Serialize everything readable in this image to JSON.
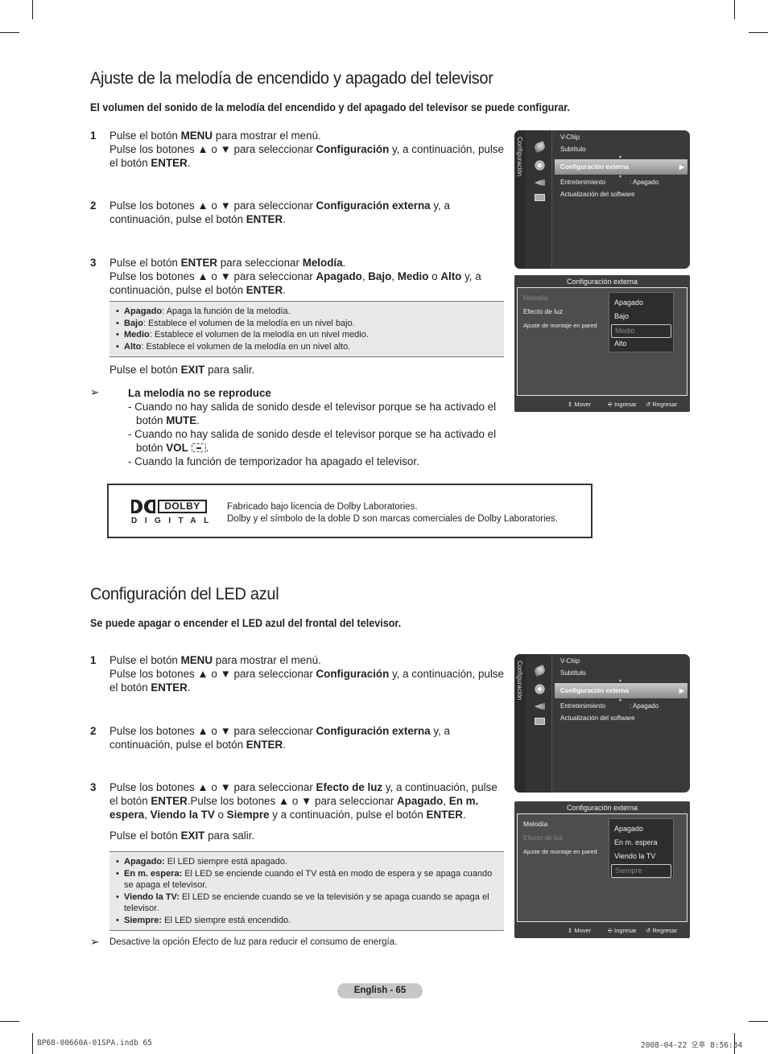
{
  "section1": {
    "title": "Ajuste de la melodía de encendido y apagado del televisor",
    "subtitle": "El volumen del sonido de la melodía del encendido y del apagado del televisor se puede configurar.",
    "steps": [
      {
        "num": "1",
        "lines": [
          [
            "Pulse el botón ",
            {
              "b": "MENU"
            },
            " para mostrar el menú."
          ],
          [
            "Pulse los botones ▲ o ▼ para seleccionar ",
            {
              "b": "Configuración"
            },
            " y, a continuación, pulse el botón ",
            {
              "b": "ENTER"
            },
            "."
          ]
        ]
      },
      {
        "num": "2",
        "lines": [
          [
            "Pulse los botones ▲ o ▼ para seleccionar ",
            {
              "b": "Configuración externa"
            },
            " y, a continuación, pulse el botón ",
            {
              "b": "ENTER"
            },
            "."
          ]
        ]
      },
      {
        "num": "3",
        "lines": [
          [
            "Pulse el botón ",
            {
              "b": "ENTER"
            },
            " para seleccionar ",
            {
              "b": "Melodía"
            },
            "."
          ],
          [
            "Pulse los botones ▲ o ▼ para seleccionar ",
            {
              "b": "Apagado"
            },
            ", ",
            {
              "b": "Bajo"
            },
            ", ",
            {
              "b": "Medio"
            },
            " o ",
            {
              "b": "Alto"
            },
            " y, a continuación, pulse el botón ",
            {
              "b": "ENTER"
            },
            "."
          ]
        ]
      }
    ],
    "options": [
      {
        "term": "Apagado",
        "desc": ": Apaga la función de la melodía."
      },
      {
        "term": "Bajo",
        "desc": ": Establece el volumen de la melodía en un nivel bajo."
      },
      {
        "term": "Medio",
        "desc": ": Establece el volumen de la melodía en un nivel medio."
      },
      {
        "term": "Alto",
        "desc": ": Establece el volumen de la melodía en un nivel alto."
      }
    ],
    "exit_pre": "Pulse el botón ",
    "exit_key": "EXIT",
    "exit_post": " para salir.",
    "note": {
      "arrow": "➢",
      "title": "La melodía no se reproduce",
      "line1_pre": "- Cuando no hay salida de sonido desde el televisor porque se ha activado el botón ",
      "line1_key": "MUTE",
      "line1_post": ".",
      "line2_pre": "- Cuando no hay salida de sonido desde el televisor porque se ha activado el botón ",
      "line2_key": "VOL",
      "line2_post": ".",
      "line3": "- Cuando la función de temporizador ha apagado el televisor."
    }
  },
  "dolby": {
    "logo_word": "DOLBY",
    "logo_sub": "DIGITAL",
    "line1": "Fabricado bajo licencia de Dolby Laboratories.",
    "line2": "Dolby y el símbolo de la doble D son marcas comerciales de Dolby Laboratories."
  },
  "section2": {
    "title": "Configuración del LED azul",
    "subtitle": "Se puede apagar o encender el LED azul del frontal del televisor.",
    "steps": [
      {
        "num": "1",
        "lines": [
          [
            "Pulse el botón ",
            {
              "b": "MENU"
            },
            " para mostrar el menú."
          ],
          [
            "Pulse los botones ▲ o ▼ para seleccionar ",
            {
              "b": "Configuración"
            },
            " y, a continuación, pulse el botón ",
            {
              "b": "ENTER"
            },
            "."
          ]
        ]
      },
      {
        "num": "2",
        "lines": [
          [
            "Pulse los botones ▲ o ▼ para seleccionar ",
            {
              "b": "Configuración externa"
            },
            " y, a continuación, pulse el botón ",
            {
              "b": "ENTER"
            },
            "."
          ]
        ]
      },
      {
        "num": "3",
        "lines": [
          [
            "Pulse los botones ▲ o ▼ para seleccionar ",
            {
              "b": "Efecto de luz"
            },
            " y, a continuación, pulse el botón ",
            {
              "b": "ENTER"
            },
            ".Pulse los botones ▲ o ▼ para seleccionar ",
            {
              "b": "Apagado"
            },
            ", ",
            {
              "b": "En m. espera"
            },
            ", ",
            {
              "b": "Viendo la TV"
            },
            " o ",
            {
              "b": "Siempre"
            },
            " y a continuación, pulse el botón ",
            {
              "b": "ENTER"
            },
            "."
          ]
        ]
      }
    ],
    "exit_pre": "Pulse el botón ",
    "exit_key": "EXIT",
    "exit_post": " para salir.",
    "options": [
      {
        "term": "Apagado:",
        "desc": " El LED siempre está apagado."
      },
      {
        "term": "En m. espera:",
        "desc": " El LED se enciende cuando el TV está en modo de espera y se apaga cuando se apaga el televisor."
      },
      {
        "term": "Viendo la TV:",
        "desc": " El LED se enciende cuando se ve la televisión y se apaga cuando se apaga el televisor."
      },
      {
        "term": "Siempre:",
        "desc": " El LED siempre está encendido."
      }
    ],
    "note_arrow": "➢",
    "note": "Desactive la opción Efecto de luz para reducir el consumo de energía."
  },
  "osd_menu": {
    "side_label": "Configuración",
    "icons": [
      "picture-icon",
      "setup-gear-icon",
      "input-icon",
      "application-icon"
    ],
    "items": [
      {
        "label": "V-Chip",
        "value": ""
      },
      {
        "label": "Subtítulo",
        "value": ""
      },
      {
        "label": "Configuración externa",
        "value": "",
        "selected": true
      },
      {
        "label": "Entretenimiento",
        "value": ": Apagado"
      },
      {
        "label": "Actualización del software",
        "value": ""
      }
    ],
    "arrow": "▶"
  },
  "osd_melody": {
    "title": "Configuración externa",
    "rows": [
      "Melodía",
      "Efecto de luz",
      "Ajuste de montaje en pared"
    ],
    "options": [
      "Apagado",
      "Bajo",
      "Medio",
      "Alto"
    ],
    "selected_option": "Medio",
    "footer": {
      "move": "Mover",
      "enter": "Ingresar",
      "return": "Regresar"
    }
  },
  "osd_led": {
    "title": "Configuración externa",
    "rows": [
      "Melodía",
      "Efecto de luz",
      "Ajuste de montaje en pared"
    ],
    "options": [
      "Apagado",
      "En m. espera",
      "Viendo la TV",
      "Siempre"
    ],
    "selected_option": "Siempre",
    "footer": {
      "move": "Mover",
      "enter": "Ingresar",
      "return": "Regresar"
    }
  },
  "page": {
    "badge": "English - 65",
    "file": "BP68-00660A-01SPA.indb   65",
    "timestamp": "2008-04-22   오후 8:56:34"
  }
}
